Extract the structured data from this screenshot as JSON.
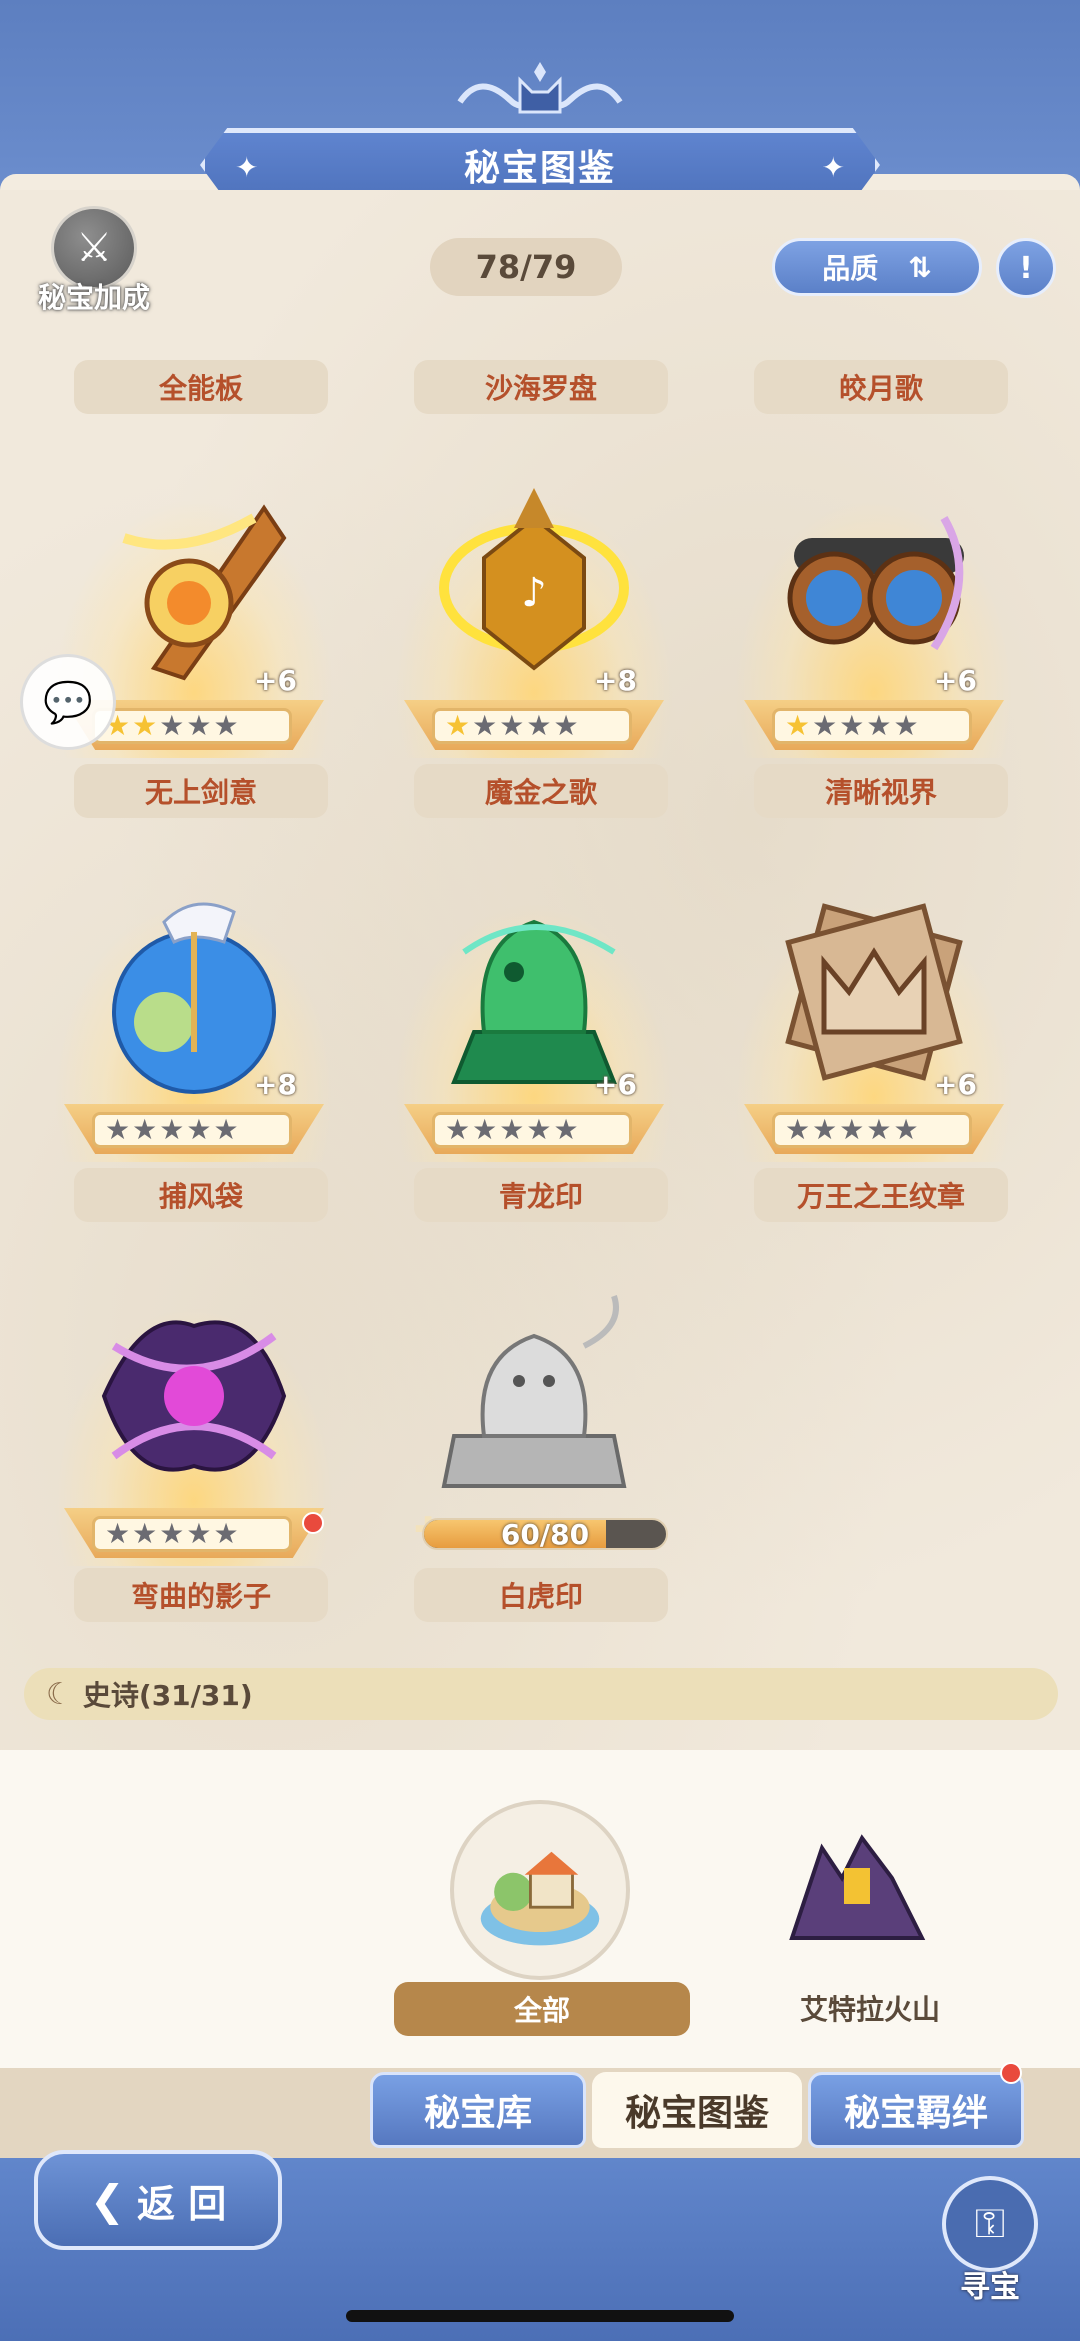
{
  "header": {
    "title": "秘宝图鉴"
  },
  "bonus": {
    "label": "秘宝加成"
  },
  "counter": "78/79",
  "quality_button": {
    "label": "品质",
    "icon": "sort-icon"
  },
  "top_row_names": [
    "全能板",
    "沙海罗盘",
    "皎月歌"
  ],
  "items": [
    {
      "name": "无上剑意",
      "stars": 2,
      "plus": "+6"
    },
    {
      "name": "魔金之歌",
      "stars": 1,
      "plus": "+8"
    },
    {
      "name": "清晰视界",
      "stars": 1,
      "plus": "+6"
    },
    {
      "name": "捕风袋",
      "stars": 0,
      "plus": "+8"
    },
    {
      "name": "青龙印",
      "stars": 0,
      "plus": "+6"
    },
    {
      "name": "万王之王纹章",
      "stars": 0,
      "plus": "+6"
    },
    {
      "name": "弯曲的影子",
      "stars": 0,
      "plus": ""
    },
    {
      "name": "白虎印",
      "progress_text": "60/80",
      "progress": 0.75
    }
  ],
  "section": {
    "label": "史诗(31/31)"
  },
  "regions": {
    "all_label": "全部",
    "volcano_label": "艾特拉火山"
  },
  "tabs": [
    "秘宝库",
    "秘宝图鉴",
    "秘宝羁绊"
  ],
  "back_button": {
    "label": "返 回"
  },
  "treasure_button": {
    "label": "寻宝"
  },
  "colors": {
    "accent_blue": "#5b80c8",
    "name_text": "#b5502b",
    "star_on": "#f6c233"
  }
}
